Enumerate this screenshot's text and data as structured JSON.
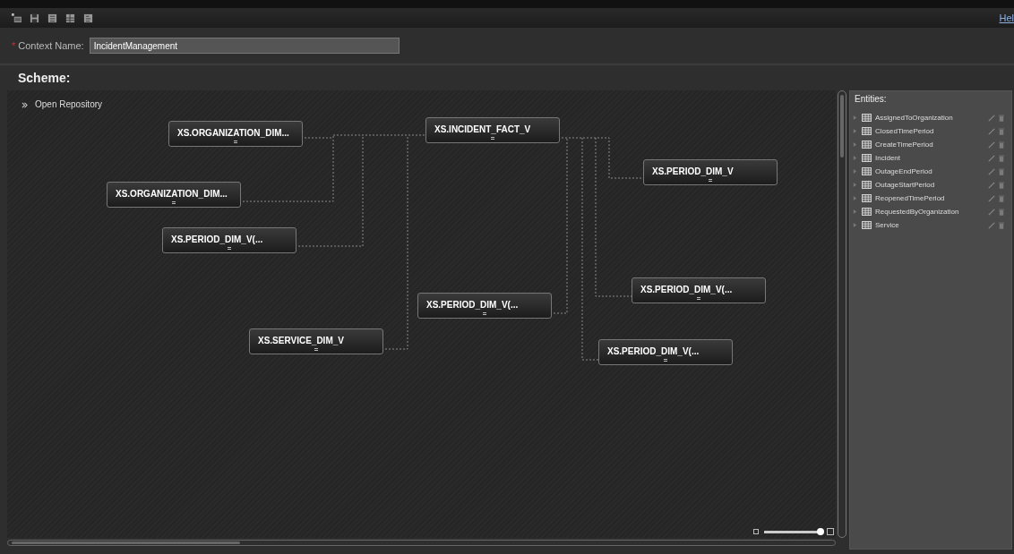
{
  "toolbar": {
    "help_link": "Hel"
  },
  "context": {
    "required_mark": "*",
    "label": "Context Name:",
    "value": "IncidentManagement"
  },
  "scheme": {
    "title": "Scheme:",
    "open_repository": "Open Repository",
    "nodes": [
      {
        "name": "XS.ORGANIZATION_DIM..."
      },
      {
        "name": "XS.ORGANIZATION_DIM..."
      },
      {
        "name": "XS.PERIOD_DIM_V(..."
      },
      {
        "name": "XS.INCIDENT_FACT_V"
      },
      {
        "name": "XS.PERIOD_DIM_V"
      },
      {
        "name": "XS.PERIOD_DIM_V(..."
      },
      {
        "name": "XS.SERVICE_DIM_V"
      },
      {
        "name": "XS.PERIOD_DIM_V(..."
      },
      {
        "name": "XS.PERIOD_DIM_V(..."
      }
    ],
    "zoom": {
      "level": 0.98
    }
  },
  "entities": {
    "title": "Entities:",
    "items": [
      {
        "name": "AssignedToOrganization",
        "expanded": false
      },
      {
        "name": "ClosedTimePeriod",
        "expanded": false
      },
      {
        "name": "CreateTimePeriod",
        "expanded": false
      },
      {
        "name": "Incident",
        "expanded": false
      },
      {
        "name": "OutageEndPeriod",
        "expanded": false
      },
      {
        "name": "OutageStartPeriod",
        "expanded": false
      },
      {
        "name": "ReopenedTimePeriod",
        "expanded": false
      },
      {
        "name": "RequestedByOrganization",
        "expanded": false
      },
      {
        "name": "Service",
        "expanded": false
      }
    ]
  }
}
